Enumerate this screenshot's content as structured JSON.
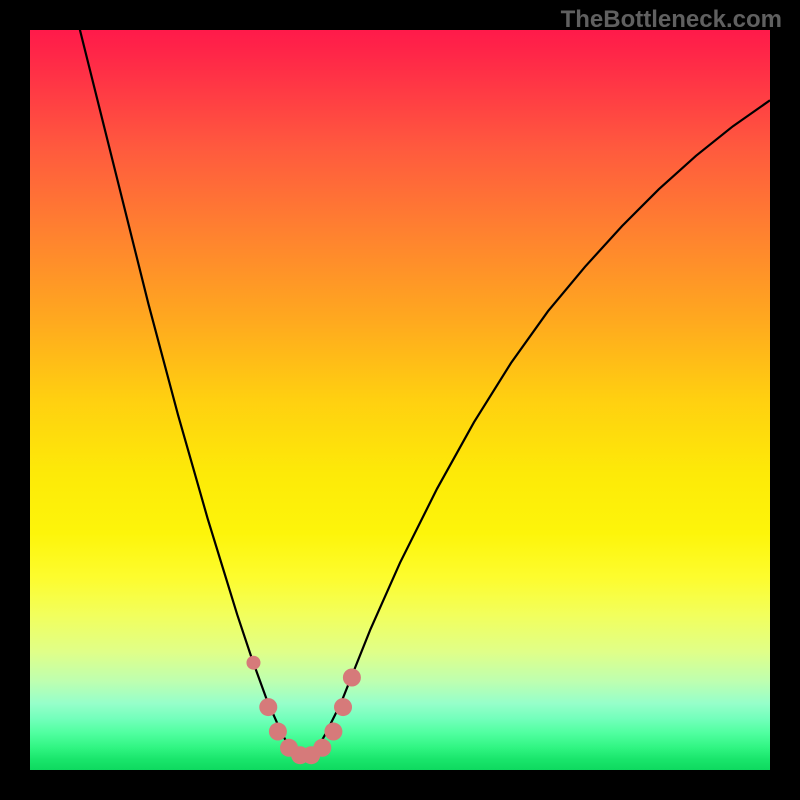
{
  "watermark": "TheBottleneck.com",
  "chart_data": {
    "type": "line",
    "title": "",
    "xlabel": "",
    "ylabel": "",
    "x_range": [
      0,
      100
    ],
    "y_range": [
      0,
      100
    ],
    "series": [
      {
        "name": "curve",
        "color": "#000000",
        "x": [
          6,
          8,
          10,
          12,
          14,
          16,
          18,
          20,
          22,
          24,
          26,
          28,
          30,
          32,
          34,
          35,
          36,
          37,
          38,
          39,
          40,
          42,
          44,
          46,
          50,
          55,
          60,
          65,
          70,
          75,
          80,
          85,
          90,
          95,
          100
        ],
        "y": [
          103,
          95,
          87,
          79,
          71,
          63,
          55.5,
          48,
          41,
          34,
          27.5,
          21,
          15,
          9.5,
          5,
          3.2,
          2.2,
          1.8,
          2.2,
          3.2,
          5,
          9,
          14,
          19,
          28,
          38,
          47,
          55,
          62,
          68,
          73.5,
          78.5,
          83,
          87,
          90.5
        ]
      }
    ],
    "markers": {
      "color": "#d67a7a",
      "big_radius": 9,
      "points": [
        {
          "x": 30.2,
          "y": 14.5,
          "r": 7
        },
        {
          "x": 32.2,
          "y": 8.5
        },
        {
          "x": 33.5,
          "y": 5.2
        },
        {
          "x": 35.0,
          "y": 3.0
        },
        {
          "x": 36.5,
          "y": 2.0
        },
        {
          "x": 38.0,
          "y": 2.0
        },
        {
          "x": 39.5,
          "y": 3.0
        },
        {
          "x": 41.0,
          "y": 5.2
        },
        {
          "x": 42.3,
          "y": 8.5
        },
        {
          "x": 43.5,
          "y": 12.5
        }
      ]
    },
    "background_gradient": [
      {
        "pos": 0.0,
        "color": "#ff1a4a"
      },
      {
        "pos": 0.5,
        "color": "#ffd010"
      },
      {
        "pos": 0.78,
        "color": "#f6ff60"
      },
      {
        "pos": 1.0,
        "color": "#0ed95f"
      }
    ]
  }
}
